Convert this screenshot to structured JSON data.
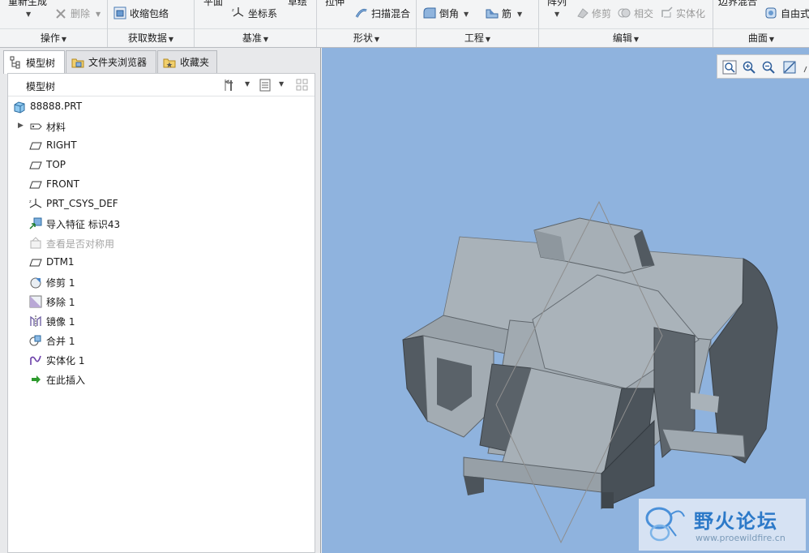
{
  "ribbon": {
    "groups": [
      {
        "label": "操作"
      },
      {
        "label": "获取数据"
      },
      {
        "label": "基准"
      },
      {
        "label": "形状"
      },
      {
        "label": "工程"
      },
      {
        "label": "编辑"
      },
      {
        "label": "曲面"
      }
    ],
    "items": {
      "regen": "重新生成",
      "delete": "删除",
      "shrinkwrap": "收缩包络",
      "plane": "平面",
      "sketch": "草绘",
      "csys": "坐标系",
      "extrude": "拉伸",
      "sweep_blend": "扫描混合",
      "round": "倒角",
      "rib": "筋",
      "pattern": "阵列",
      "trim": "修剪",
      "intersect": "相交",
      "solidify": "实体化",
      "boundary_blend": "边界混合",
      "freestyle": "自由式"
    }
  },
  "panel": {
    "tabs": [
      {
        "label": "模型树"
      },
      {
        "label": "文件夹浏览器"
      },
      {
        "label": "收藏夹"
      }
    ],
    "tree_title": "模型树",
    "tree": [
      {
        "label": "88888.PRT",
        "icon": "part-icon"
      },
      {
        "label": "材料",
        "icon": "material-icon"
      },
      {
        "label": "RIGHT",
        "icon": "datum-plane-icon"
      },
      {
        "label": "TOP",
        "icon": "datum-plane-icon"
      },
      {
        "label": "FRONT",
        "icon": "datum-plane-icon"
      },
      {
        "label": "PRT_CSYS_DEF",
        "icon": "csys-icon"
      },
      {
        "label": "导入特征 标识43",
        "icon": "import-feature-icon"
      },
      {
        "label": "查看是否对称用",
        "icon": "suppressed-feature-icon"
      },
      {
        "label": "DTM1",
        "icon": "datum-plane-icon"
      },
      {
        "label": "修剪 1",
        "icon": "trim-icon"
      },
      {
        "label": "移除 1",
        "icon": "remove-icon"
      },
      {
        "label": "镜像 1",
        "icon": "mirror-icon"
      },
      {
        "label": "合并 1",
        "icon": "merge-icon"
      },
      {
        "label": "实体化 1",
        "icon": "solidify-icon"
      },
      {
        "label": "在此插入",
        "icon": "insert-here-icon"
      }
    ]
  },
  "watermark": {
    "title": "野火论坛",
    "url": "www.proewildfire.cn"
  },
  "colors": {
    "viewport_bg": "#8fb3de",
    "model_light": "#a3acb3",
    "model_dark": "#4f575e",
    "accent": "#2c79c8"
  }
}
